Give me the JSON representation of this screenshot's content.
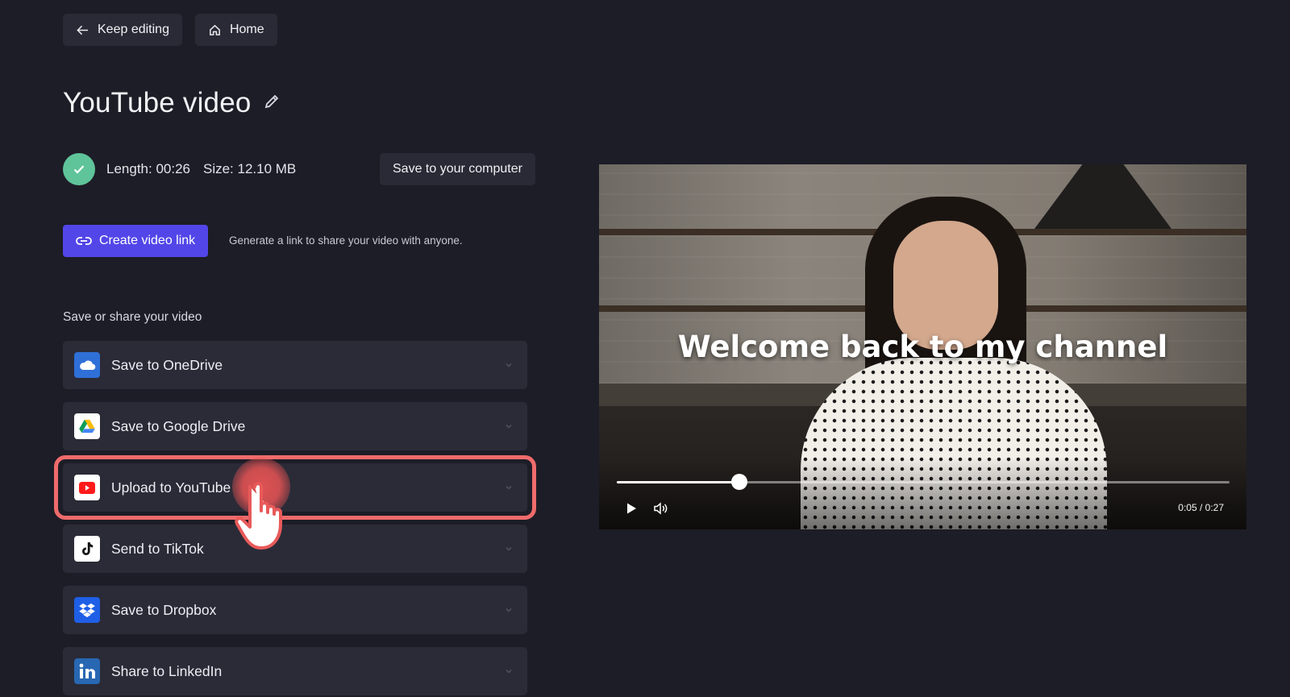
{
  "topbar": {
    "keep_editing": "Keep editing",
    "home": "Home"
  },
  "page": {
    "title": "YouTube video"
  },
  "info": {
    "length": "Length: 00:26",
    "size": "Size: 12.10 MB",
    "save_computer": "Save to your computer"
  },
  "link": {
    "button": "Create video link",
    "hint": "Generate a link to share your video with anyone."
  },
  "share": {
    "section_label": "Save or share your video",
    "items": [
      {
        "label": "Save to OneDrive",
        "icon": "onedrive-icon"
      },
      {
        "label": "Save to Google Drive",
        "icon": "google-drive-icon"
      },
      {
        "label": "Upload to YouTube",
        "icon": "youtube-icon"
      },
      {
        "label": "Send to TikTok",
        "icon": "tiktok-icon"
      },
      {
        "label": "Save to Dropbox",
        "icon": "dropbox-icon"
      },
      {
        "label": "Share to LinkedIn",
        "icon": "linkedin-icon"
      }
    ]
  },
  "video": {
    "caption": "Welcome back to my channel",
    "time": "0:05 / 0:27",
    "progress_fraction": 0.2
  },
  "colors": {
    "accent": "#5246e8",
    "highlight": "#ef6b6b",
    "success": "#5fc49a",
    "background": "#1d1d27"
  }
}
